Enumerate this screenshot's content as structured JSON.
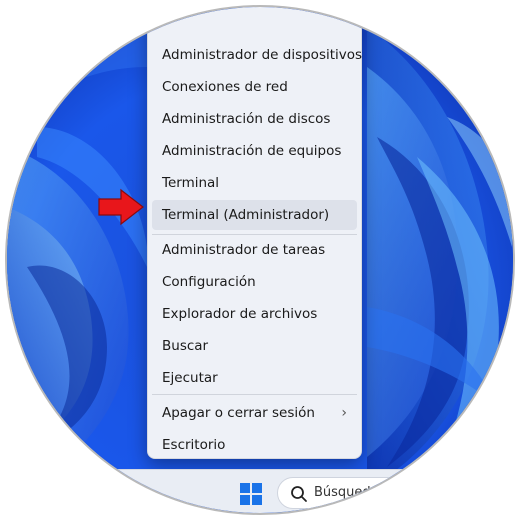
{
  "context_menu": {
    "items": [
      {
        "label": "Administrador de dispositivos"
      },
      {
        "label": "Conexiones de red"
      },
      {
        "label": "Administración de discos"
      },
      {
        "label": "Administración de equipos"
      },
      {
        "label": "Terminal"
      },
      {
        "label": "Terminal (Administrador)"
      },
      {
        "label": "Administrador de tareas"
      },
      {
        "label": "Configuración"
      },
      {
        "label": "Explorador de archivos"
      },
      {
        "label": "Buscar"
      },
      {
        "label": "Ejecutar"
      },
      {
        "label": "Apagar o cerrar sesión"
      },
      {
        "label": "Escritorio"
      }
    ],
    "submenu_chevron": "›",
    "highlighted_index": 5
  },
  "taskbar": {
    "search_text": "Búsqueda",
    "start_icon": "windows-logo-icon",
    "search_icon": "magnifier-icon"
  },
  "annotation": {
    "arrow_color": "#e8161b",
    "arrow_icon": "red-arrow-icon"
  },
  "colors": {
    "wallpaper_blue": "#1d5fe6",
    "menu_bg": "#eef1f7",
    "highlight_bg": "#dde1ea",
    "windows_logo": "#1a73e8"
  }
}
